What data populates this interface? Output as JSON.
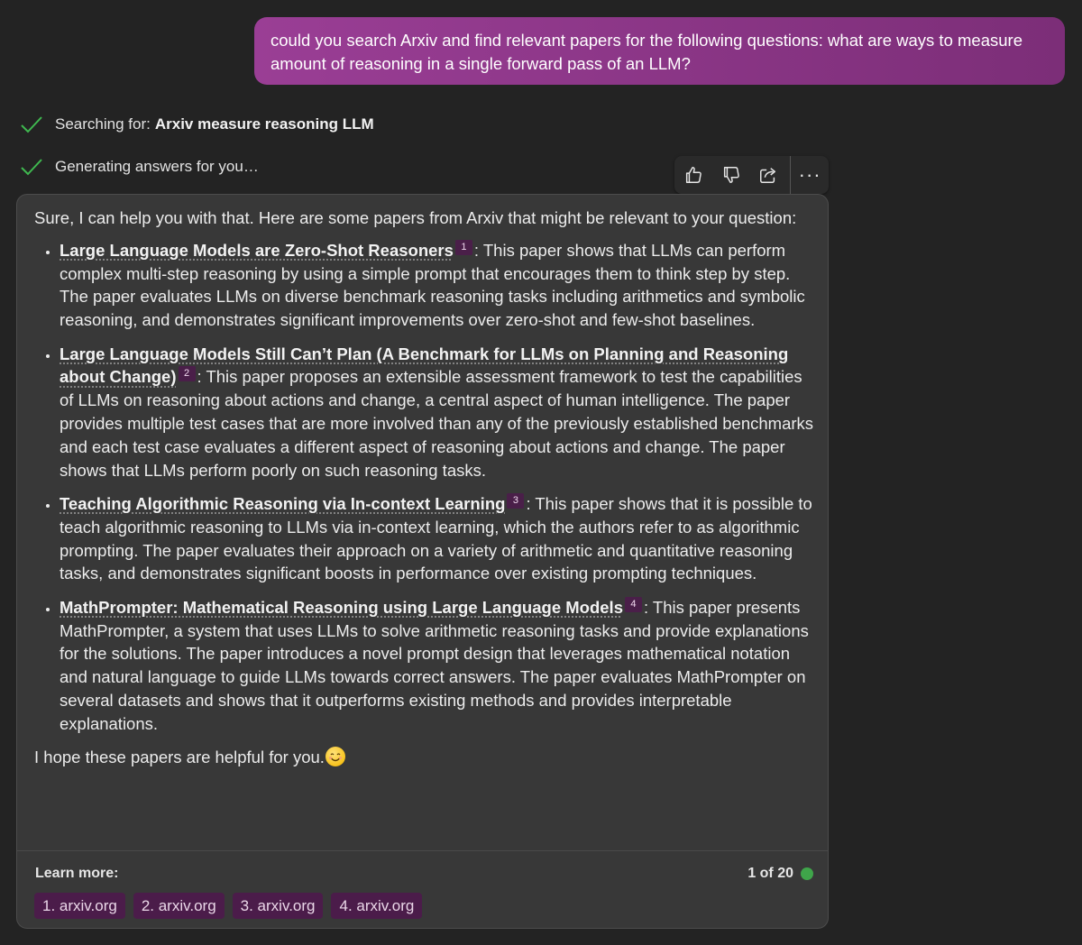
{
  "user_message": "could you search Arxiv and find relevant papers for the following questions: what are ways to measure amount of reasoning in a single forward pass of an LLM?",
  "status": {
    "search_prefix": "Searching for:",
    "search_query": "Arxiv measure reasoning LLM",
    "generating": "Generating answers for you…"
  },
  "toolbar": {
    "like_icon": "thumbs-up-icon",
    "dislike_icon": "thumbs-down-icon",
    "share_icon": "share-icon",
    "more_label": "···"
  },
  "answer": {
    "intro": "Sure, I can help you with that. Here are some papers from Arxiv that might be relevant to your question:",
    "papers": [
      {
        "title": "Large Language Models are Zero-Shot Reasoners",
        "cite": "1",
        "desc": ": This paper shows that LLMs can perform complex multi-step reasoning by using a simple prompt that encourages them to think step by step. The paper evaluates LLMs on diverse benchmark reasoning tasks including arithmetics and symbolic reasoning, and demonstrates significant improvements over zero-shot and few-shot baselines."
      },
      {
        "title": "Large Language Models Still Can’t Plan (A Benchmark for LLMs on Planning and Reasoning about Change)",
        "cite": "2",
        "desc": ": This paper proposes an extensible assessment framework to test the capabilities of LLMs on reasoning about actions and change, a central aspect of human intelligence. The paper provides multiple test cases that are more involved than any of the previously established benchmarks and each test case evaluates a different aspect of reasoning about actions and change. The paper shows that LLMs perform poorly on such reasoning tasks."
      },
      {
        "title": "Teaching Algorithmic Reasoning via In-context Learning",
        "cite": "3",
        "desc": ": This paper shows that it is possible to teach algorithmic reasoning to LLMs via in-context learning, which the authors refer to as algorithmic prompting. The paper evaluates their approach on a variety of arithmetic and quantitative reasoning tasks, and demonstrates significant boosts in performance over existing prompting techniques."
      },
      {
        "title": "MathPrompter: Mathematical Reasoning using Large Language Models",
        "cite": "4",
        "desc": ": This paper presents MathPrompter, a system that uses LLMs to solve arithmetic reasoning tasks and provide explanations for the solutions. The paper introduces a novel prompt design that leverages mathematical notation and natural language to guide LLMs towards correct answers. The paper evaluates MathPrompter on several datasets and shows that it outperforms existing methods and provides interpretable explanations."
      }
    ],
    "closing": "I hope these papers are helpful for you.",
    "closing_emoji": "smiling-face-emoji"
  },
  "footer": {
    "learn_more": "Learn more:",
    "pager": "1 of 20",
    "status_color": "#3fa54a",
    "sources": [
      "1. arxiv.org",
      "2. arxiv.org",
      "3. arxiv.org",
      "4. arxiv.org"
    ]
  },
  "colors": {
    "background": "#232323",
    "user_bubble": "#8e3889",
    "card": "#383838",
    "check": "#3fb950",
    "citation": "#4a1f49"
  }
}
